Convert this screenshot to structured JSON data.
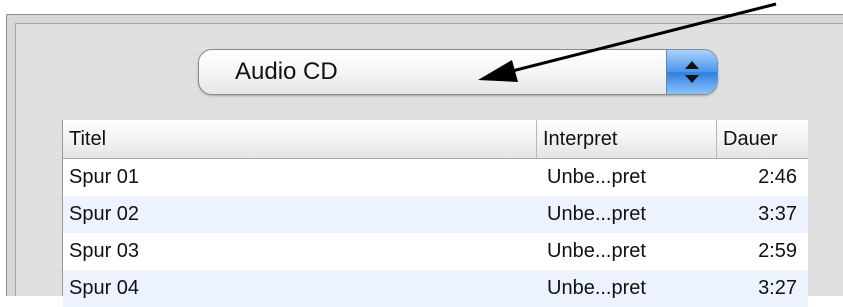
{
  "source_popup": {
    "selected": "Audio CD",
    "stepper_icon": "up-down-chevron-icon",
    "accent": "#4a95ec"
  },
  "annotation": {
    "arrow_color": "#000000"
  },
  "track_table": {
    "columns": [
      "Titel",
      "Interpret",
      "Dauer"
    ],
    "rows": [
      {
        "title": "Spur 01",
        "artist": "Unbe...pret",
        "duration": "2:46"
      },
      {
        "title": "Spur 02",
        "artist": "Unbe...pret",
        "duration": "3:37"
      },
      {
        "title": "Spur 03",
        "artist": "Unbe...pret",
        "duration": "2:59"
      },
      {
        "title": "Spur 04",
        "artist": "Unbe...pret",
        "duration": "3:27"
      }
    ],
    "alternate_row_color": "#edf3fe"
  }
}
